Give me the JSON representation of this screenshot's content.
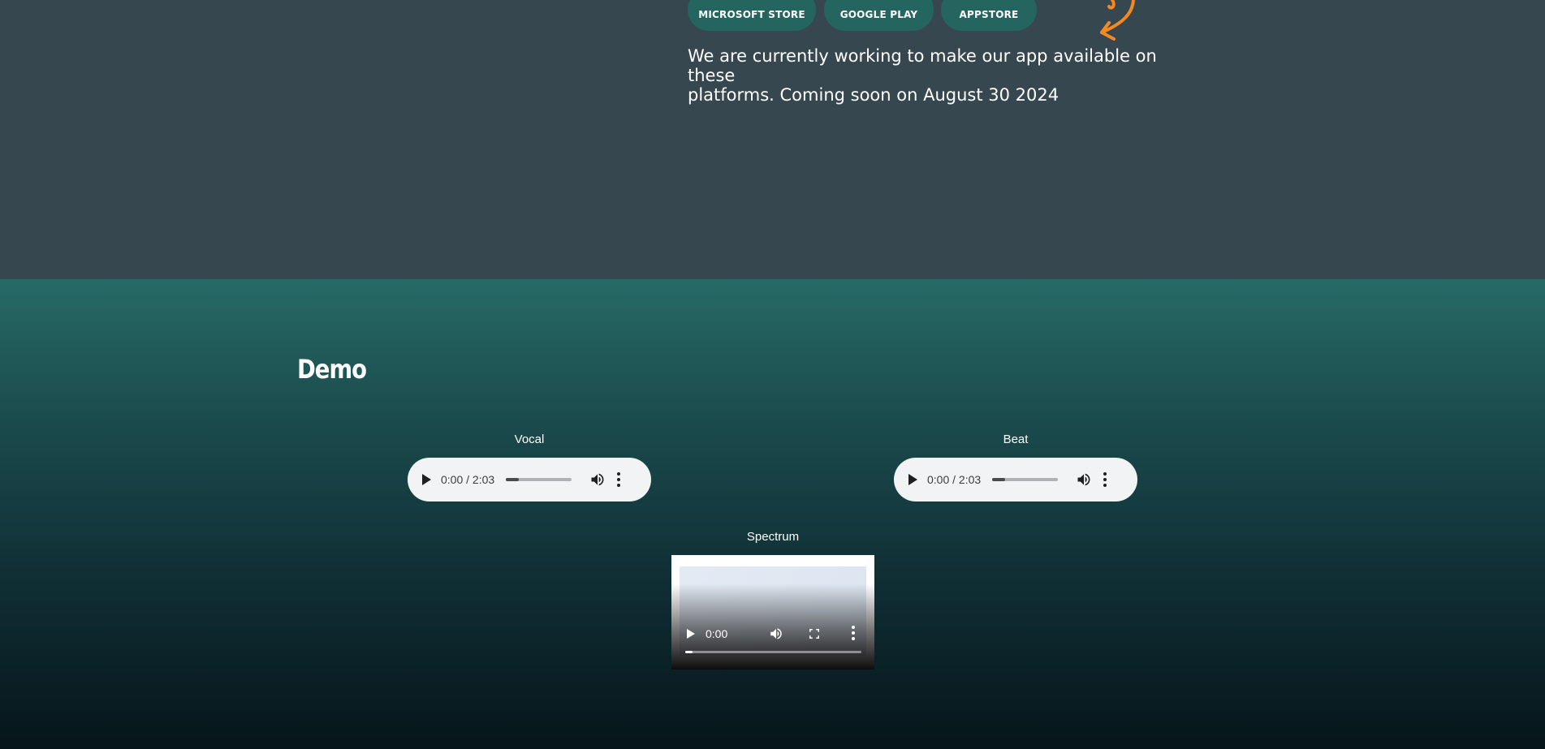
{
  "stores": {
    "microsoft": "MICROSOFT STORE",
    "google": "GOOGLE PLAY",
    "apple": "APPSTORE"
  },
  "notice": {
    "line1": "We are currently working to make our app available on these",
    "line2": "platforms. Coming soon on August 30 2024"
  },
  "accent_color": "#f5891f",
  "demo": {
    "title": "Demo",
    "vocal": {
      "label": "Vocal",
      "time": "0:00 / 2:03",
      "progress_fraction": 0.2
    },
    "beat": {
      "label": "Beat",
      "time": "0:00 / 2:03",
      "progress_fraction": 0.2
    },
    "spectrum": {
      "label": "Spectrum",
      "time": "0:00",
      "progress_fraction": 0.04
    }
  },
  "icons": {
    "play": "play-icon",
    "volume": "volume-icon",
    "more": "more-options-icon",
    "fullscreen": "fullscreen-icon",
    "arrow": "curved-arrow-icon"
  }
}
